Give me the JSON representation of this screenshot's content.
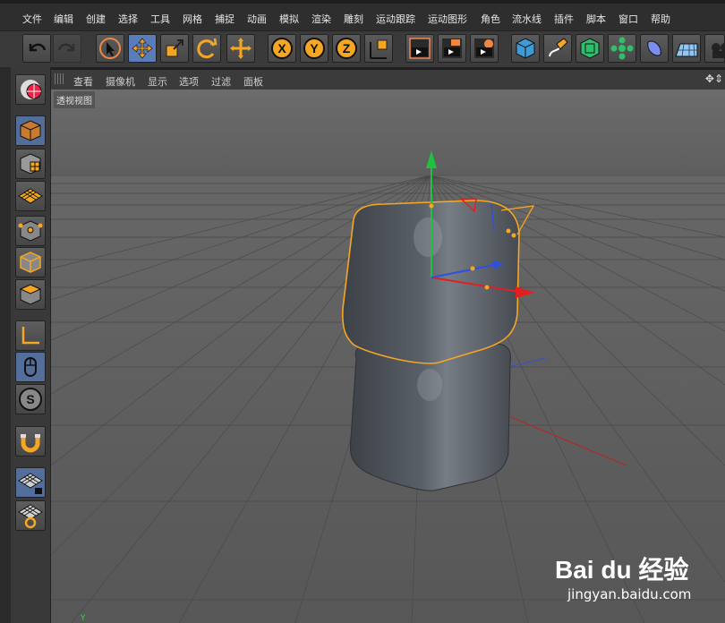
{
  "menu": [
    "文件",
    "编辑",
    "创建",
    "选择",
    "工具",
    "网格",
    "捕捉",
    "动画",
    "模拟",
    "渲染",
    "雕刻",
    "运动跟踪",
    "运动图形",
    "角色",
    "流水线",
    "插件",
    "脚本",
    "窗口",
    "帮助"
  ],
  "viewport_menu": [
    "查看",
    "摄像机",
    "显示",
    "选项",
    "过滤",
    "面板"
  ],
  "viewport_label": "透视视图",
  "watermark": {
    "logo": "Bai du 经验",
    "domain": "jingyan.baidu.com"
  },
  "axis_corner": "Y",
  "colors": {
    "accent": "#f5a623",
    "selection": "#5a7cb8",
    "x_axis": "#e02020",
    "y_axis": "#20c040",
    "z_axis": "#3050e0"
  },
  "toolbar_icons": [
    "undo-icon",
    "redo-icon",
    "live-select-icon",
    "move-icon",
    "scale-icon",
    "rotate-icon",
    "create-move-icon",
    "x-axis-lock-icon",
    "y-axis-lock-icon",
    "z-axis-lock-icon",
    "coordinate-system-icon",
    "render-view-icon",
    "render-picture-viewer-icon",
    "render-settings-icon",
    "cube-object-icon",
    "pen-spline-icon",
    "subdivision-icon",
    "array-clone-icon",
    "deformer-icon",
    "floor-icon"
  ],
  "left_icons": [
    "viewport-solo-icon",
    "model-mode-icon",
    "texture-mode-icon",
    "workplane-mode-icon",
    "point-mode-icon",
    "edge-mode-icon",
    "polygon-mode-icon",
    "axis-mode-icon",
    "tweak-mode-icon",
    "solo-s-icon",
    "snap-magnet-icon",
    "locked-workplane-icon",
    "workplane-icon"
  ]
}
